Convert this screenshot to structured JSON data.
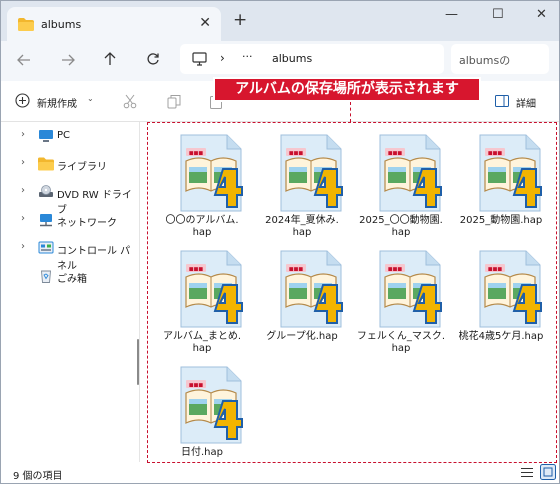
{
  "window": {
    "tab_title": "albums",
    "new_tab": "+",
    "close_tab": "✕",
    "controls": [
      "—",
      "☐",
      "✕"
    ]
  },
  "nav": {
    "more": "···",
    "path_separator": "›",
    "path_current": "albums",
    "search_placeholder": "albumsの"
  },
  "toolbar": {
    "new_label": "新規作成",
    "details_label": "詳細"
  },
  "callout": "アルバムの保存場所が表示されます",
  "sidebar": {
    "items": [
      {
        "label": "PC",
        "icon": "pc-icon"
      },
      {
        "label": "ライブラリ",
        "icon": "library-folder-icon"
      },
      {
        "label": "DVD RW ドライブ",
        "icon": "dvd-drive-icon"
      },
      {
        "label": "ネットワーク",
        "icon": "network-icon"
      },
      {
        "label": "コントロール パネル",
        "icon": "control-panel-icon"
      },
      {
        "label": "ごみ箱",
        "icon": "recycle-bin-icon"
      }
    ]
  },
  "files": [
    {
      "name": "〇〇のアルバム.\nhap"
    },
    {
      "name": "2024年_夏休み.\nhap"
    },
    {
      "name": "2025_〇〇動物園.\nhap"
    },
    {
      "name": "2025_動物園.hap"
    },
    {
      "name": "アルバム_まとめ.\nhap"
    },
    {
      "name": "グループ化.hap"
    },
    {
      "name": "フェルくん_マスク.\nhap"
    },
    {
      "name": "桃花4歳5ケ月.hap"
    },
    {
      "name": "日付.hap"
    }
  ],
  "status": {
    "item_count": "9 個の項目"
  },
  "colors": {
    "accent_red": "#d7162e",
    "tab_bar": "#dfe6ef",
    "nav_bar": "#f3f6fa"
  }
}
